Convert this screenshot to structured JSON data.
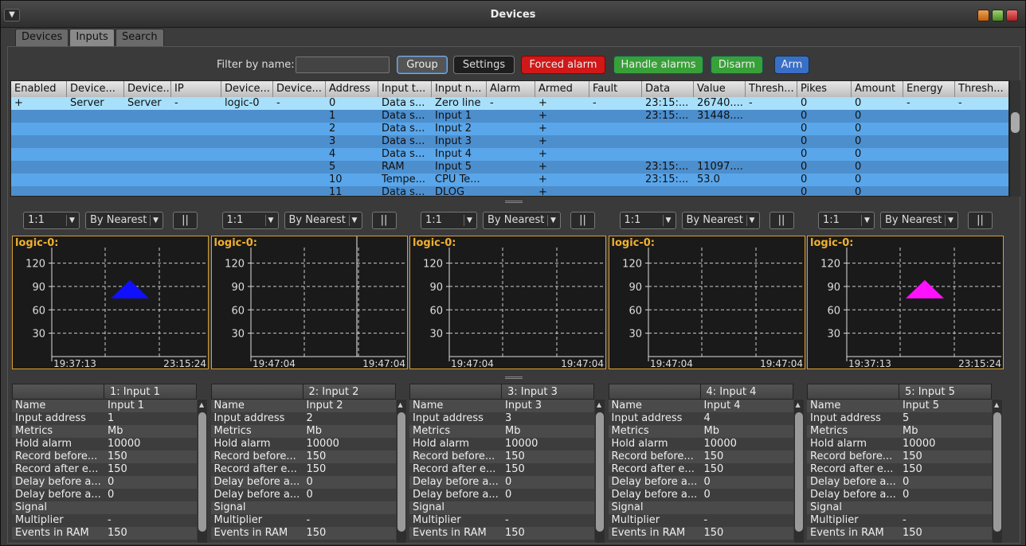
{
  "window": {
    "title": "Devices"
  },
  "tabs": [
    {
      "label": "Devices"
    },
    {
      "label": "Inputs"
    },
    {
      "label": "Search"
    }
  ],
  "toolbar": {
    "filter_label": "Filter by name:",
    "filter_value": "",
    "group_label": "Group",
    "settings_label": "Settings",
    "forced_alarm_label": "Forced alarm",
    "handle_alarms_label": "Handle alarms",
    "disarm_label": "Disarm",
    "arm_label": "Arm"
  },
  "table": {
    "columns": [
      "Enabled",
      "Device...",
      "Device...",
      "IP",
      "Device...",
      "Device...",
      "Address",
      "Input t...",
      "Input n...",
      "Alarm",
      "Armed",
      "Fault",
      "Data",
      "Value",
      "Thresh...",
      "Pikes",
      "Amount",
      "Energy",
      "Thresh..."
    ],
    "rows": [
      [
        "+",
        "Server",
        "Server",
        "-",
        "logic-0",
        "-",
        "0",
        "Data s...",
        "Zero line",
        "-",
        "+",
        "-",
        "23:15:...",
        "26740....",
        "-",
        "0",
        "0",
        "-",
        "-"
      ],
      [
        "",
        "",
        "",
        "",
        "",
        "",
        "1",
        "Data s...",
        "Input 1",
        "",
        "+",
        "",
        "23:15:...",
        "31448....",
        "",
        "0",
        "0",
        "",
        ""
      ],
      [
        "",
        "",
        "",
        "",
        "",
        "",
        "2",
        "Data s...",
        "Input 2",
        "",
        "+",
        "",
        "",
        "",
        "",
        "0",
        "0",
        "",
        ""
      ],
      [
        "",
        "",
        "",
        "",
        "",
        "",
        "3",
        "Data s...",
        "Input 3",
        "",
        "+",
        "",
        "",
        "",
        "",
        "0",
        "0",
        "",
        ""
      ],
      [
        "",
        "",
        "",
        "",
        "",
        "",
        "4",
        "Data s...",
        "Input 4",
        "",
        "+",
        "",
        "",
        "",
        "",
        "0",
        "0",
        "",
        ""
      ],
      [
        "",
        "",
        "",
        "",
        "",
        "",
        "5",
        "RAM",
        "Input 5",
        "",
        "+",
        "",
        "23:15:...",
        "11097....",
        "",
        "0",
        "0",
        "",
        ""
      ],
      [
        "",
        "",
        "",
        "",
        "",
        "",
        "10",
        "Tempe...",
        "CPU Te...",
        "",
        "+",
        "",
        "23:15:...",
        "53.0",
        "",
        "0",
        "0",
        "",
        ""
      ],
      [
        "",
        "",
        "",
        "",
        "",
        "",
        "11",
        "Data s...",
        "DLOG",
        "",
        "+",
        "",
        "",
        "",
        "",
        "0",
        "0",
        "",
        ""
      ]
    ]
  },
  "chart_controls": [
    {
      "scale": "1:1",
      "mode": "By Nearest",
      "pause": "||"
    },
    {
      "scale": "1:1",
      "mode": "By Nearest",
      "pause": "||"
    },
    {
      "scale": "1:1",
      "mode": "By Nearest",
      "pause": "||"
    },
    {
      "scale": "1:1",
      "mode": "By Nearest",
      "pause": "||"
    },
    {
      "scale": "1:1",
      "mode": "By Nearest",
      "pause": "||"
    }
  ],
  "chart_data": [
    {
      "type": "scatter",
      "title": "logic-0:",
      "yticks": [
        30,
        60,
        90,
        120
      ],
      "ylim": [
        0,
        140
      ],
      "xlabel_left": "19:37:13",
      "xlabel_right": "23:15:24",
      "marker_color": "#1010ff",
      "marker_value": 90
    },
    {
      "type": "scatter",
      "title": "logic-0:",
      "yticks": [
        30,
        60,
        90,
        120
      ],
      "ylim": [
        0,
        140
      ],
      "xlabel_left": "19:47:04",
      "xlabel_right": "19:47:04"
    },
    {
      "type": "scatter",
      "title": "logic-0:",
      "yticks": [
        30,
        60,
        90,
        120
      ],
      "ylim": [
        0,
        140
      ],
      "xlabel_left": "19:47:04",
      "xlabel_right": "19:47:04"
    },
    {
      "type": "scatter",
      "title": "logic-0:",
      "yticks": [
        30,
        60,
        90,
        120
      ],
      "ylim": [
        0,
        140
      ],
      "xlabel_left": "19:47:04",
      "xlabel_right": "19:47:04"
    },
    {
      "type": "scatter",
      "title": "logic-0:",
      "yticks": [
        30,
        60,
        90,
        120
      ],
      "ylim": [
        0,
        140
      ],
      "xlabel_left": "19:37:13",
      "xlabel_right": "23:15:24",
      "marker_color": "#ff10ff",
      "marker_value": 90
    }
  ],
  "properties": [
    {
      "title": "1: Input 1",
      "rows": [
        [
          "Name",
          "Input 1"
        ],
        [
          "Input address",
          "1"
        ],
        [
          "Metrics",
          "Mb"
        ],
        [
          "Hold alarm",
          "10000"
        ],
        [
          "Record before...",
          "150"
        ],
        [
          "Record after e...",
          "150"
        ],
        [
          "Delay before a...",
          "0"
        ],
        [
          "Delay before a...",
          "0"
        ],
        [
          "Signal",
          ""
        ],
        [
          "Multiplier",
          "-"
        ],
        [
          "Events in RAM",
          "150"
        ]
      ]
    },
    {
      "title": "2: Input 2",
      "rows": [
        [
          "Name",
          "Input 2"
        ],
        [
          "Input address",
          "2"
        ],
        [
          "Metrics",
          "Mb"
        ],
        [
          "Hold alarm",
          "10000"
        ],
        [
          "Record before...",
          "150"
        ],
        [
          "Record after e...",
          "150"
        ],
        [
          "Delay before a...",
          "0"
        ],
        [
          "Delay before a...",
          "0"
        ],
        [
          "Signal",
          ""
        ],
        [
          "Multiplier",
          "-"
        ],
        [
          "Events in RAM",
          "150"
        ]
      ]
    },
    {
      "title": "3: Input 3",
      "rows": [
        [
          "Name",
          "Input 3"
        ],
        [
          "Input address",
          "3"
        ],
        [
          "Metrics",
          "Mb"
        ],
        [
          "Hold alarm",
          "10000"
        ],
        [
          "Record before...",
          "150"
        ],
        [
          "Record after e...",
          "150"
        ],
        [
          "Delay before a...",
          "0"
        ],
        [
          "Delay before a...",
          "0"
        ],
        [
          "Signal",
          ""
        ],
        [
          "Multiplier",
          "-"
        ],
        [
          "Events in RAM",
          "150"
        ]
      ]
    },
    {
      "title": "4: Input 4",
      "rows": [
        [
          "Name",
          "Input 4"
        ],
        [
          "Input address",
          "4"
        ],
        [
          "Metrics",
          "Mb"
        ],
        [
          "Hold alarm",
          "10000"
        ],
        [
          "Record before...",
          "150"
        ],
        [
          "Record after e...",
          "150"
        ],
        [
          "Delay before a...",
          "0"
        ],
        [
          "Delay before a...",
          "0"
        ],
        [
          "Signal",
          ""
        ],
        [
          "Multiplier",
          "-"
        ],
        [
          "Events in RAM",
          "150"
        ]
      ]
    },
    {
      "title": "5: Input 5",
      "rows": [
        [
          "Name",
          "Input 5"
        ],
        [
          "Input address",
          "5"
        ],
        [
          "Metrics",
          "Mb"
        ],
        [
          "Hold alarm",
          "10000"
        ],
        [
          "Record before...",
          "150"
        ],
        [
          "Record after e...",
          "150"
        ],
        [
          "Delay before a...",
          "0"
        ],
        [
          "Delay before a...",
          "0"
        ],
        [
          "Signal",
          ""
        ],
        [
          "Multiplier",
          "-"
        ],
        [
          "Events in RAM",
          "150"
        ]
      ]
    }
  ]
}
